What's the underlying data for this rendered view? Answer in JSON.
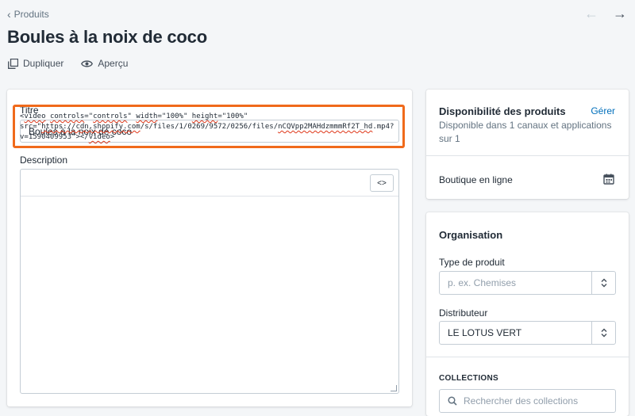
{
  "breadcrumb": {
    "label": "Produits"
  },
  "page": {
    "title": "Boules à la noix de coco"
  },
  "actions": {
    "duplicate": "Dupliquer",
    "preview": "Aperçu"
  },
  "product": {
    "title_label": "Titre",
    "title_value": "Boules à la noix de coco",
    "description_label": "Description",
    "code_toggle": "<>",
    "code": {
      "p1": "<",
      "w_video_open": "video",
      "p2": " ",
      "w_controls": "controls",
      "p3": "=\"",
      "w_controls2": "controls",
      "p4": "\" ",
      "w_width": "width",
      "p5": "=\"100%\" ",
      "w_height": "height",
      "p6": "=\"100%\"\nsrc=\"",
      "w_url": "https://cdn.shopify.com",
      "p7": "/s/files/1/0269/9572/0256/files/",
      "w_file": "nCQVpp2MAHdzmmmRf2T_hd",
      "p8": ".mp4?v=1590409953\"></",
      "w_video_close": "video",
      "p9": ">"
    }
  },
  "availability": {
    "title": "Disponibilité des produits",
    "manage": "Gérer",
    "subtitle": "Disponible dans 1 canaux et applications sur 1",
    "channel": "Boutique en ligne"
  },
  "organisation": {
    "title": "Organisation",
    "type_label": "Type de produit",
    "type_placeholder": "p. ex. Chemises",
    "vendor_label": "Distributeur",
    "vendor_value": "LE LOTUS VERT",
    "collections_label": "COLLECTIONS",
    "collections_placeholder": "Rechercher des collections"
  },
  "colors": {
    "highlight": "#f06a1b",
    "link": "#006fbb",
    "spellcheck": "#de3618"
  }
}
